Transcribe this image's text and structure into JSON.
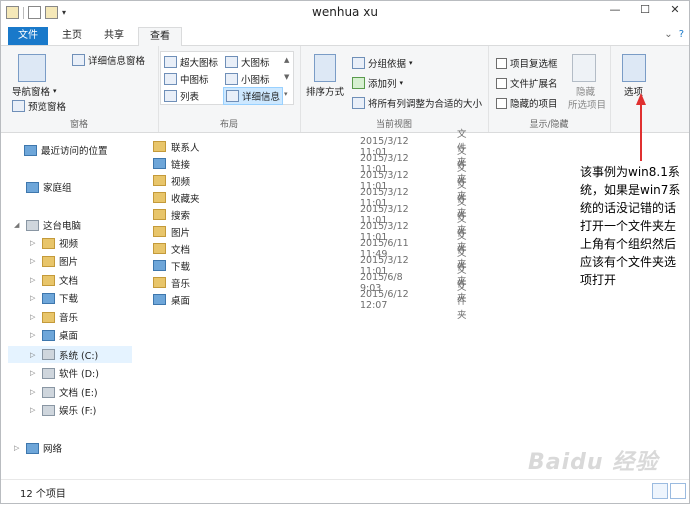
{
  "window": {
    "title": "wenhua xu"
  },
  "tabs": {
    "file": "文件",
    "home": "主页",
    "share": "共享",
    "view": "查看"
  },
  "ribbon": {
    "panes": {
      "nav_pane": "导航窗格",
      "preview_pane": "预览窗格",
      "details_pane": "详细信息窗格",
      "group_label": "窗格"
    },
    "layout": {
      "xlarge": "超大图标",
      "large": "大图标",
      "medium": "中图标",
      "small": "小图标",
      "list": "列表",
      "details": "详细信息",
      "group_label": "布局"
    },
    "current_view": {
      "sort_by": "排序方式",
      "group_by": "分组依据",
      "add_column": "添加列",
      "fit_columns": "将所有列调整为合适的大小",
      "group_label": "当前视图"
    },
    "show_hide": {
      "item_checkboxes": "项目复选框",
      "file_extensions": "文件扩展名",
      "hidden_items": "隐藏的项目",
      "hide_selected": "隐藏",
      "hide_selected_2": "所选项目",
      "group_label": "显示/隐藏"
    },
    "options": {
      "label": "选项"
    }
  },
  "nav": {
    "recent": "最近访问的位置",
    "homegroup": "家庭组",
    "this_pc": "这台电脑",
    "videos": "视频",
    "pictures": "图片",
    "documents": "文档",
    "downloads": "下载",
    "music": "音乐",
    "desktop": "桌面",
    "drive_c": "系统 (C:)",
    "drive_d": "软件 (D:)",
    "drive_e": "文档 (E:)",
    "drive_f": "娱乐 (F:)",
    "network": "网络"
  },
  "files": [
    {
      "name": "联系人",
      "date": "2015/3/12 11:01",
      "type": "文件夹"
    },
    {
      "name": "链接",
      "date": "2015/3/12 11:01",
      "type": "文件夹"
    },
    {
      "name": "视频",
      "date": "2015/3/12 11:01",
      "type": "文件夹"
    },
    {
      "name": "收藏夹",
      "date": "2015/3/12 11:01",
      "type": "文件夹"
    },
    {
      "name": "搜索",
      "date": "2015/3/12 11:01",
      "type": "文件夹"
    },
    {
      "name": "图片",
      "date": "2015/3/12 11:01",
      "type": "文件夹"
    },
    {
      "name": "文档",
      "date": "2015/6/11 11:49",
      "type": "文件夹"
    },
    {
      "name": "下载",
      "date": "2015/3/12 11:01",
      "type": "文件夹"
    },
    {
      "name": "音乐",
      "date": "2015/6/8 9:03",
      "type": "文件夹"
    },
    {
      "name": "桌面",
      "date": "2015/6/12 12:07",
      "type": "文件夹"
    }
  ],
  "status": {
    "count": "12 个项目"
  },
  "annotation": {
    "line1": "该事例为win8.1系",
    "line2": "统，如果是win7系",
    "line3": "统的话没记错的话",
    "line4": "打开一个文件夹左",
    "line5": "上角有个组织然后",
    "line6": "应该有个文件夹选",
    "line7": "项打开"
  },
  "watermark": "Baidu 经验"
}
